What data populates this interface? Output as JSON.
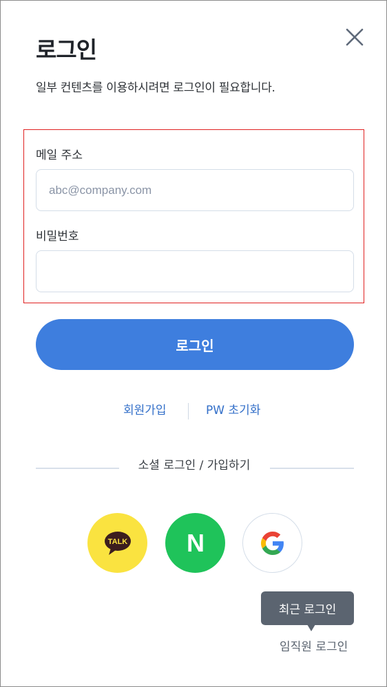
{
  "header": {
    "title": "로그인",
    "subtitle": "일부 컨텐츠를 이용하시려면 로그인이 필요합니다."
  },
  "form": {
    "email_label": "메일 주소",
    "email_placeholder": "abc@company.com",
    "email_value": "",
    "password_label": "비밀번호",
    "password_value": ""
  },
  "actions": {
    "login_label": "로그인",
    "signup_label": "회원가입",
    "reset_pw_label": "PW 초기화"
  },
  "social": {
    "caption": "소셜 로그인 / 가입하기",
    "providers": [
      {
        "name": "kakao",
        "badge": "TALK",
        "color": "#fae340"
      },
      {
        "name": "naver",
        "badge": "N",
        "color": "#1fc35a"
      },
      {
        "name": "google",
        "badge": "G",
        "color": "#ffffff"
      }
    ]
  },
  "recent": {
    "tooltip": "최근 로그인",
    "staff_login_label": "임직원 로그인"
  },
  "colors": {
    "accent": "#3e7ede",
    "link": "#3470c9",
    "highlight_border": "#e02020"
  },
  "icons": {
    "close": "close-icon"
  }
}
